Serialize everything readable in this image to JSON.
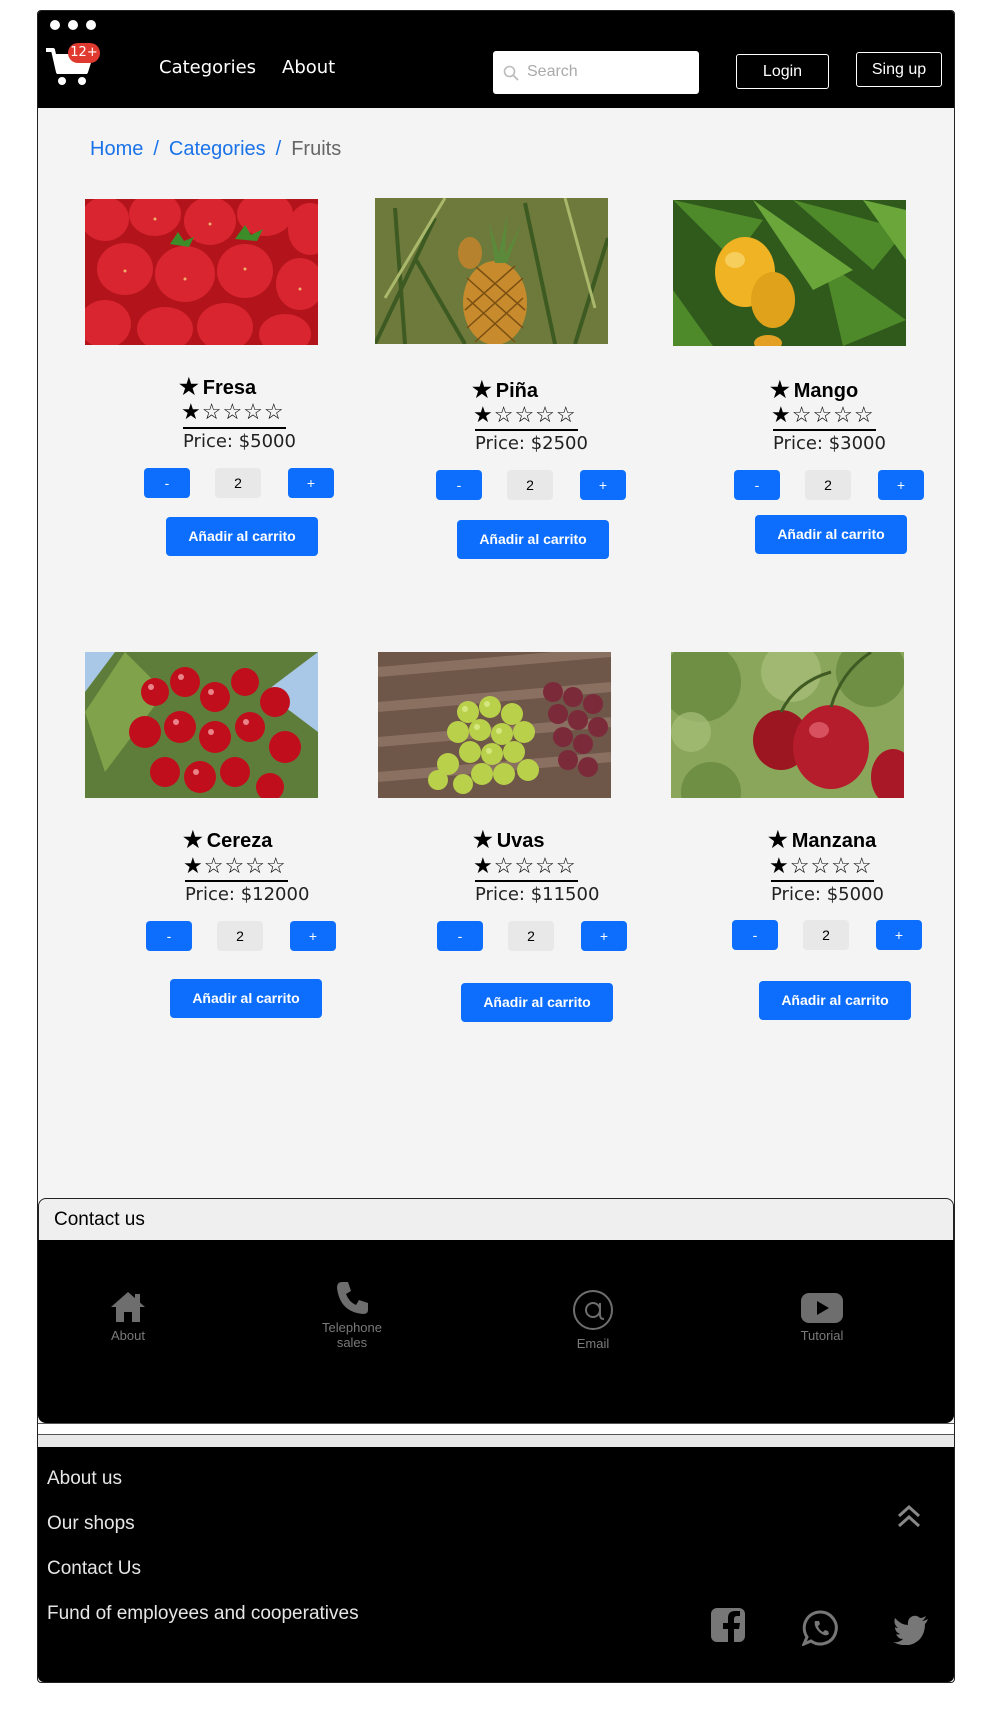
{
  "header": {
    "cart_badge": "12+",
    "nav": [
      "Categories",
      "About"
    ],
    "search_placeholder": "Search",
    "login_label": "Login",
    "signup_label": "Sing up"
  },
  "breadcrumb": {
    "items": [
      "Home",
      "Categories"
    ],
    "separator": "/",
    "current": "Fruits"
  },
  "products": [
    {
      "name": "Fresa",
      "rating": 1,
      "price": "Price: $5000",
      "qty": "2",
      "add_label": "Añadir al carrito",
      "minus": "-",
      "plus": "+"
    },
    {
      "name": "Piña",
      "rating": 1,
      "price": "Price: $2500",
      "qty": "2",
      "add_label": "Añadir al carrito",
      "minus": "-",
      "plus": "+"
    },
    {
      "name": "Mango",
      "rating": 1,
      "price": "Price: $3000",
      "qty": "2",
      "add_label": "Añadir al carrito",
      "minus": "-",
      "plus": "+"
    },
    {
      "name": "Cereza",
      "rating": 1,
      "price": "Price: $12000",
      "qty": "2",
      "add_label": "Añadir al carrito",
      "minus": "-",
      "plus": "+"
    },
    {
      "name": "Uvas",
      "rating": 1,
      "price": "Price: $11500",
      "qty": "2",
      "add_label": "Añadir al carrito",
      "minus": "-",
      "plus": "+"
    },
    {
      "name": "Manzana",
      "rating": 1,
      "price": "Price: $5000",
      "qty": "2",
      "add_label": "Añadir al carrito",
      "minus": "-",
      "plus": "+"
    }
  ],
  "contact": {
    "title": "Contact us",
    "items": [
      {
        "icon": "home-icon",
        "label": "About"
      },
      {
        "icon": "phone-icon",
        "label": "Telephone sales"
      },
      {
        "icon": "at-icon",
        "label": "Email"
      },
      {
        "icon": "youtube-icon",
        "label": "Tutorial"
      }
    ]
  },
  "footer": {
    "links": [
      "About us",
      "Our shops",
      "Contact Us",
      "Fund of employees and cooperatives"
    ],
    "social_icons": [
      "facebook-icon",
      "whatsapp-icon",
      "twitter-icon"
    ],
    "scroll_top_icon": "chevrons-up-icon"
  },
  "colors": {
    "accent": "#0d6efd",
    "link": "#1a73e8",
    "badge": "#e0392f",
    "bar": "#000000",
    "page": "#f4f4f4"
  }
}
